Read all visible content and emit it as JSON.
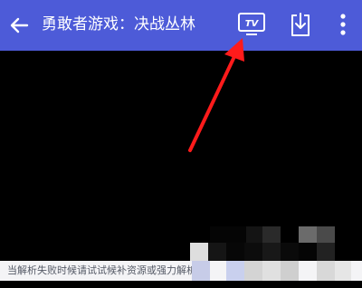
{
  "appbar": {
    "title": "勇敢者游戏：决战丛林",
    "back_icon": "arrow-left-icon",
    "tv_label": "TV",
    "tv_icon": "tv-cast-icon",
    "download_icon": "download-icon",
    "more_icon": "more-vert-icon"
  },
  "player": {
    "hint": "当解析失败时候请试试候补资源或强力解析"
  },
  "colors": {
    "appbar": "#4d5bd8",
    "annotation_arrow": "#ff1b1b",
    "player_bg": "#000000"
  }
}
